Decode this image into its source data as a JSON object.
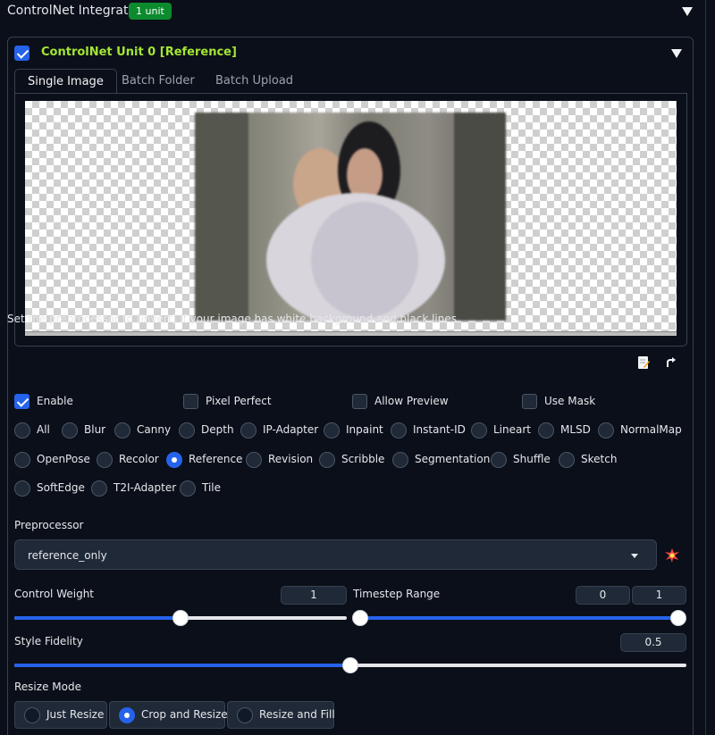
{
  "accordion": {
    "title": "ControlNet Integrated",
    "badge": "1 unit"
  },
  "unit": {
    "enabled_check": true,
    "title": "ControlNet Unit 0 [Reference]",
    "tabs": [
      {
        "label": "Single Image",
        "active": true
      },
      {
        "label": "Batch Folder",
        "active": false
      },
      {
        "label": "Batch Upload",
        "active": false
      }
    ],
    "hint": "Set the preprocessor to [invert] If your image has white background and black lines.",
    "icons": {
      "edit": "edit-icon",
      "send": "send-arrow-icon",
      "run_preprocessor": "explosion-icon"
    },
    "options": {
      "enable": {
        "label": "Enable",
        "checked": true
      },
      "pixel_perfect": {
        "label": "Pixel Perfect",
        "checked": false
      },
      "allow_preview": {
        "label": "Allow Preview",
        "checked": false
      },
      "use_mask": {
        "label": "Use Mask",
        "checked": false
      }
    },
    "control_types": [
      "All",
      "Blur",
      "Canny",
      "Depth",
      "IP-Adapter",
      "Inpaint",
      "Instant-ID",
      "Lineart",
      "MLSD",
      "NormalMap",
      "OpenPose",
      "Recolor",
      "Reference",
      "Revision",
      "Scribble",
      "Segmentation",
      "Shuffle",
      "Sketch",
      "SoftEdge",
      "T2I-Adapter",
      "Tile"
    ],
    "control_type_selected": "Reference",
    "preprocessor": {
      "label": "Preprocessor",
      "value": "reference_only"
    },
    "control_weight": {
      "label": "Control Weight",
      "value": "1",
      "fraction": 0.5
    },
    "timestep_range": {
      "label": "Timestep Range",
      "start": "0",
      "end": "1",
      "start_fraction": 0,
      "end_fraction": 1
    },
    "style_fidelity": {
      "label": "Style Fidelity",
      "value": "0.5",
      "fraction": 0.5
    },
    "resize_mode": {
      "label": "Resize Mode",
      "options": [
        "Just Resize",
        "Crop and Resize",
        "Resize and Fill"
      ],
      "selected": "Crop and Resize"
    }
  },
  "colors": {
    "accent": "#2563eb",
    "unit_title": "#a3e635",
    "badge": "#0c8b2e",
    "background": "#0b0f19"
  }
}
